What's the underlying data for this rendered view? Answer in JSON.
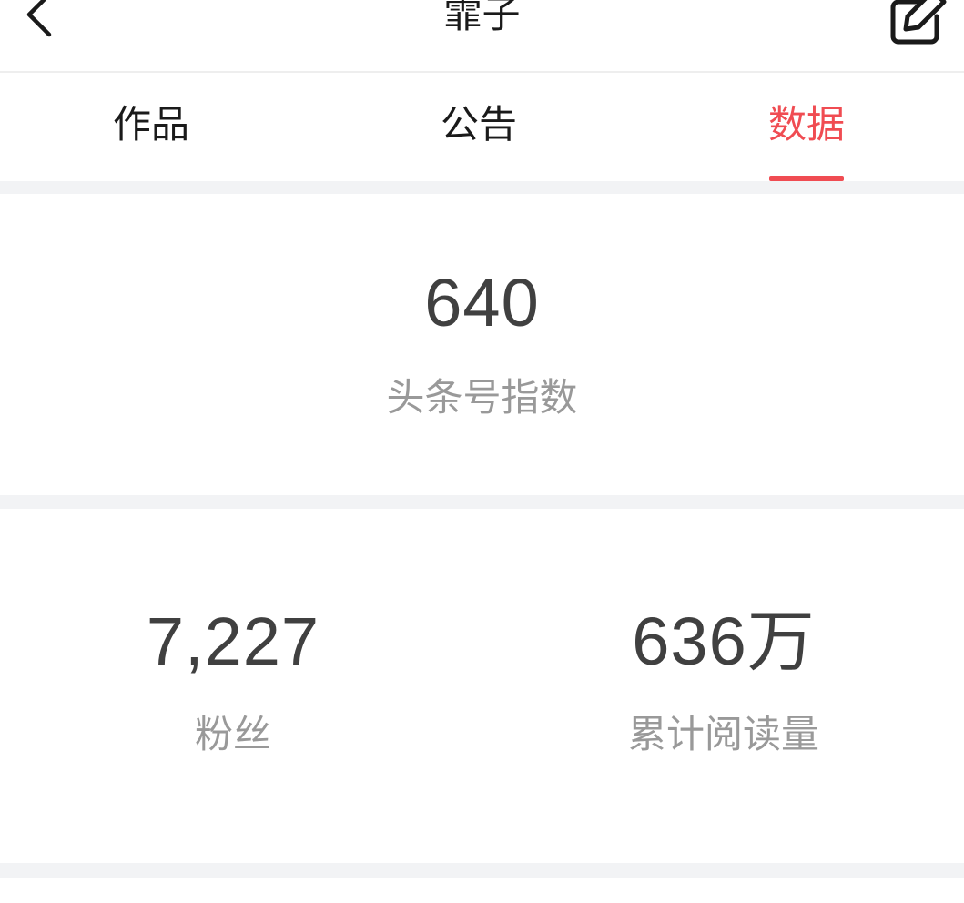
{
  "header": {
    "title": "霏子",
    "back_icon": "chevron-left-icon",
    "edit_icon": "edit-icon"
  },
  "tabs": [
    {
      "label": "作品",
      "active": false
    },
    {
      "label": "公告",
      "active": false
    },
    {
      "label": "数据",
      "active": true
    }
  ],
  "colors": {
    "accent": "#f04c52",
    "text_primary": "#1a1a1a",
    "value_text": "#404040",
    "label_text": "#999999",
    "separator": "#f2f3f5"
  },
  "index_card": {
    "value": "640",
    "label": "头条号指数"
  },
  "stats_card": {
    "fans": {
      "value": "7,227",
      "label": "粉丝"
    },
    "reads": {
      "value": "636万",
      "label": "累计阅读量"
    }
  }
}
